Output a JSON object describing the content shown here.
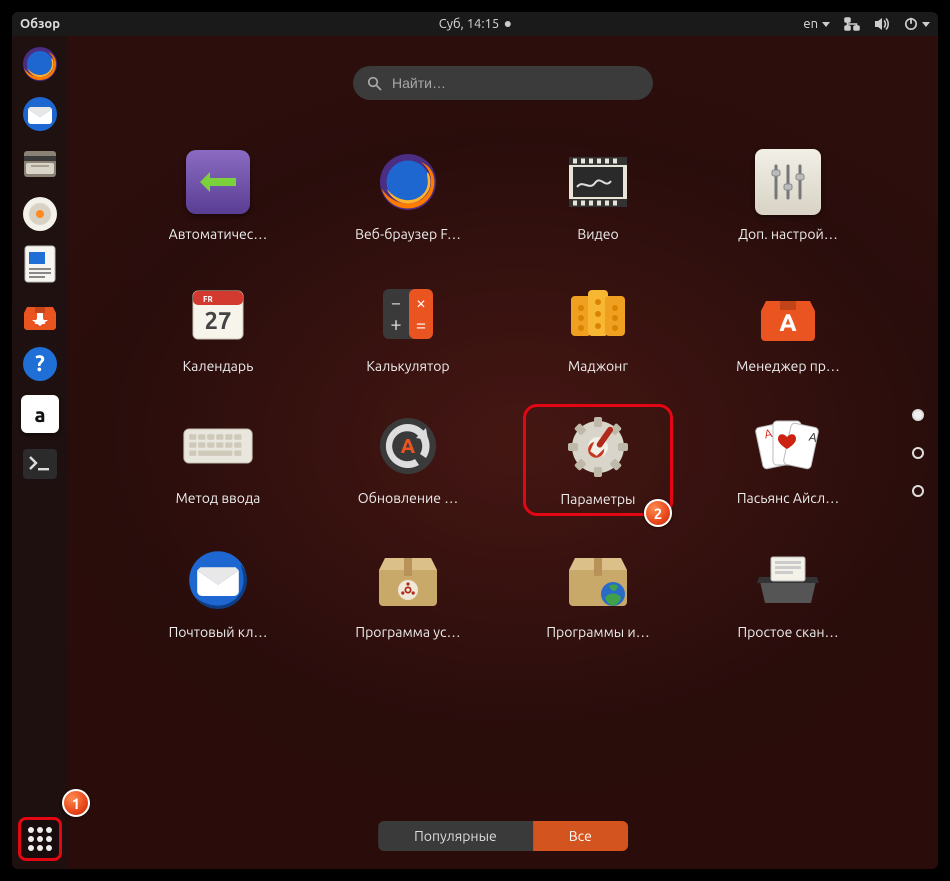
{
  "topbar": {
    "activities": "Обзор",
    "clock": "Суб, 14:15",
    "lang": "en"
  },
  "search": {
    "placeholder": "Найти…"
  },
  "dock": {
    "items": [
      {
        "name": "firefox"
      },
      {
        "name": "thunderbird"
      },
      {
        "name": "files"
      },
      {
        "name": "rhythmbox"
      },
      {
        "name": "writer"
      },
      {
        "name": "software"
      },
      {
        "name": "help"
      },
      {
        "name": "amazon"
      },
      {
        "name": "terminal"
      }
    ]
  },
  "apps": [
    {
      "id": "automatic",
      "label": "Автоматичес…"
    },
    {
      "id": "firefox",
      "label": "Веб-браузер F…"
    },
    {
      "id": "video",
      "label": "Видео"
    },
    {
      "id": "tweaks",
      "label": "Доп. настрой…"
    },
    {
      "id": "calendar",
      "label": "Календарь",
      "day": "27",
      "wd": "FR"
    },
    {
      "id": "calculator",
      "label": "Калькулятор"
    },
    {
      "id": "mahjongg",
      "label": "Маджонг"
    },
    {
      "id": "software-mgr",
      "label": "Менеджер пр…"
    },
    {
      "id": "ibus",
      "label": "Метод ввода"
    },
    {
      "id": "updater",
      "label": "Обновление …"
    },
    {
      "id": "settings",
      "label": "Параметры"
    },
    {
      "id": "aisleriot",
      "label": "Пасьянс Айсл…"
    },
    {
      "id": "thunderbird",
      "label": "Почтовый кл…"
    },
    {
      "id": "installer",
      "label": "Программа ус…"
    },
    {
      "id": "software-sources",
      "label": "Программы и…"
    },
    {
      "id": "simple-scan",
      "label": "Простое скан…"
    }
  ],
  "toggle": {
    "frequent": "Популярные",
    "all": "Все",
    "active": "all"
  },
  "pager": {
    "pages": 3,
    "active": 0
  },
  "annotations": {
    "one": "1",
    "two": "2"
  }
}
